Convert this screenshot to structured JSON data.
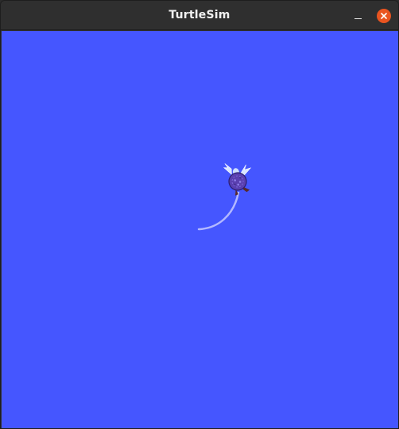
{
  "window": {
    "title": "TurtleSim",
    "controls": {
      "minimize_icon": "minimize-icon",
      "close_icon": "close-icon"
    }
  },
  "canvas": {
    "background_color": "#4556ff",
    "pen_color": "#b3b8ff",
    "turtle": {
      "icon": "turtle-icon",
      "shell_color": "#5a3fb0"
    }
  }
}
